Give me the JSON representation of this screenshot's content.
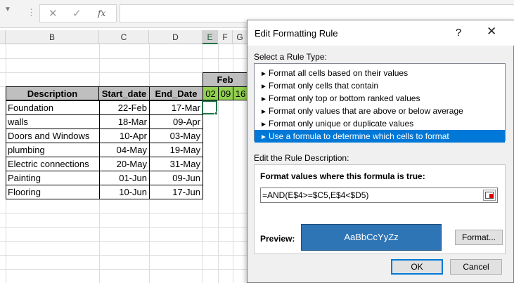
{
  "formula_bar": {
    "cancel_glyph": "✕",
    "enter_glyph": "✓",
    "fx_label": "fx",
    "value": ""
  },
  "columns": [
    "B",
    "C",
    "D",
    "E",
    "F",
    "G"
  ],
  "sheet": {
    "month_header": "Feb",
    "table_headers": [
      "Description",
      "Start_date",
      "End_Date"
    ],
    "date_headers": [
      "02",
      "09",
      "16"
    ],
    "rows": [
      {
        "description": "Foundation",
        "start": "22-Feb",
        "end": "17-Mar"
      },
      {
        "description": "walls",
        "start": "18-Mar",
        "end": "09-Apr"
      },
      {
        "description": "Doors and Windows",
        "start": "10-Apr",
        "end": "03-May"
      },
      {
        "description": "plumbing",
        "start": "04-May",
        "end": "19-May"
      },
      {
        "description": "Electric connections",
        "start": "20-May",
        "end": "31-May"
      },
      {
        "description": "Painting",
        "start": "01-Jun",
        "end": "09-Jun"
      },
      {
        "description": "Flooring",
        "start": "10-Jun",
        "end": "17-Jun"
      }
    ]
  },
  "dialog": {
    "title": "Edit Formatting Rule",
    "help": "?",
    "close": "✕",
    "select_rule_type_label": "Select a Rule Type:",
    "rule_types": [
      "Format all cells based on their values",
      "Format only cells that contain",
      "Format only top or bottom ranked values",
      "Format only values that are above or below average",
      "Format only unique or duplicate values",
      "Use a formula to determine which cells to format"
    ],
    "selected_rule_index": 5,
    "edit_description_label": "Edit the Rule Description:",
    "formula_label": "Format values where this formula is true:",
    "formula_value": "=AND(E$4>=$C5,E$4<$D5)",
    "preview_label": "Preview:",
    "preview_text": "AaBbCcYyZz",
    "format_button": "Format...",
    "ok_button": "OK",
    "cancel_button": "Cancel"
  },
  "colors": {
    "accent": "#0078d7",
    "preview_fill": "#2e75b6",
    "date_header_fill": "#92d050",
    "table_header_fill": "#bfbfbf",
    "selection": "#217346"
  }
}
